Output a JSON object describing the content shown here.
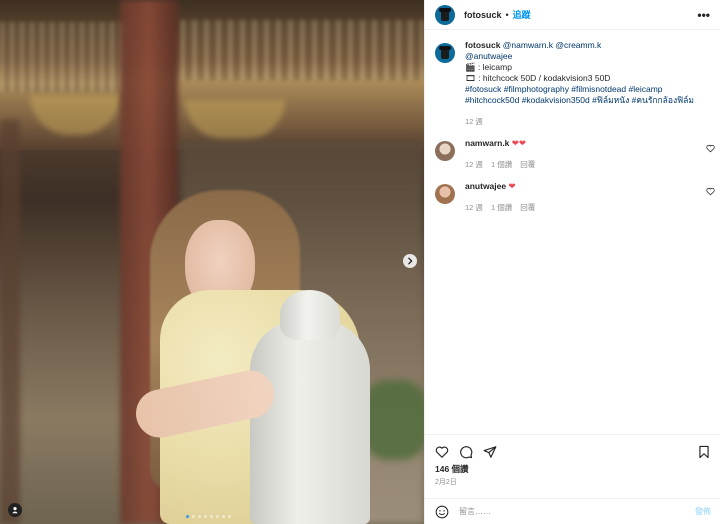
{
  "post": {
    "username": "fotosuck",
    "separator": "•",
    "follow_label": "追蹤",
    "more_label": "•••"
  },
  "caption": {
    "username": "fotosuck",
    "line1_mentions": "@namwarn.k @creamm.k",
    "line2_mentions": "@anutwajee",
    "line3": "🎬 : leicamp",
    "line4": "🎞 : hitchcock 50D / kodakvision3 50D",
    "hashtags1": "#fotosuck #filmphotography #filmisnotdead #leicamp",
    "hashtags2": "#hitchcock50d #kodakvision350d #ฟิล์มหนัง #คนรักกล้องฟิล์ม",
    "time": "12 週"
  },
  "comments": [
    {
      "username": "namwarn.k",
      "text": "❤❤",
      "time": "12 週",
      "likes": "1 個讚",
      "reply": "回覆"
    },
    {
      "username": "anutwajee",
      "text": "❤",
      "time": "12 週",
      "likes": "1 個讚",
      "reply": "回覆"
    }
  ],
  "stats": {
    "likes": "146 個讚",
    "date": "2月2日"
  },
  "composer": {
    "placeholder": "留言……",
    "post_label": "發佈"
  },
  "carousel": {
    "count": 8,
    "active_index": 0
  },
  "colors": {
    "link": "#00376b",
    "accent": "#0095f6",
    "heart": "#ed4956",
    "muted": "#8e8e8e"
  }
}
